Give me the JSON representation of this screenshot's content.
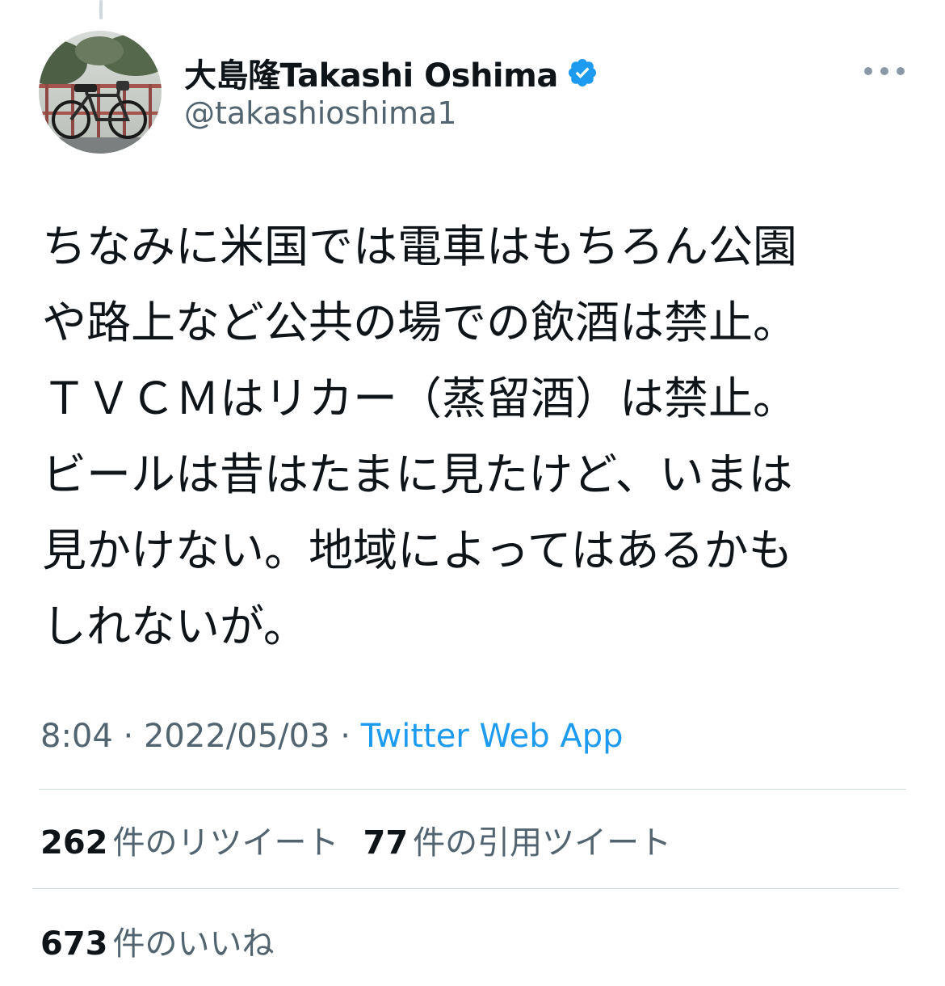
{
  "author": {
    "display_name": "大島隆Takashi Oshima",
    "handle": "@takashioshima1",
    "verified": true,
    "verified_color": "#1d9bf0",
    "avatar_icon": "bicycle-photo-avatar"
  },
  "menu": {
    "icon": "more-options-icon"
  },
  "tweet": {
    "text": "ちなみに米国では電車はもちろん公園\nや路上など公共の場での飲酒は禁止。\nＴＶＣＭはリカー（蒸留酒）は禁止。\nビールは昔はたまに見たけど、いまは\n見かけない。地域によってはあるかも\nしれないが。"
  },
  "meta": {
    "time": "8:04",
    "separator": "·",
    "date": "2022/05/03",
    "source": "Twitter Web App",
    "source_color": "#1d9bf0"
  },
  "stats": {
    "retweets": {
      "count": "262",
      "label": "件のリツイート"
    },
    "quotes": {
      "count": "77",
      "label": "件の引用ツイート"
    },
    "likes": {
      "count": "673",
      "label": "件のいいね"
    }
  }
}
